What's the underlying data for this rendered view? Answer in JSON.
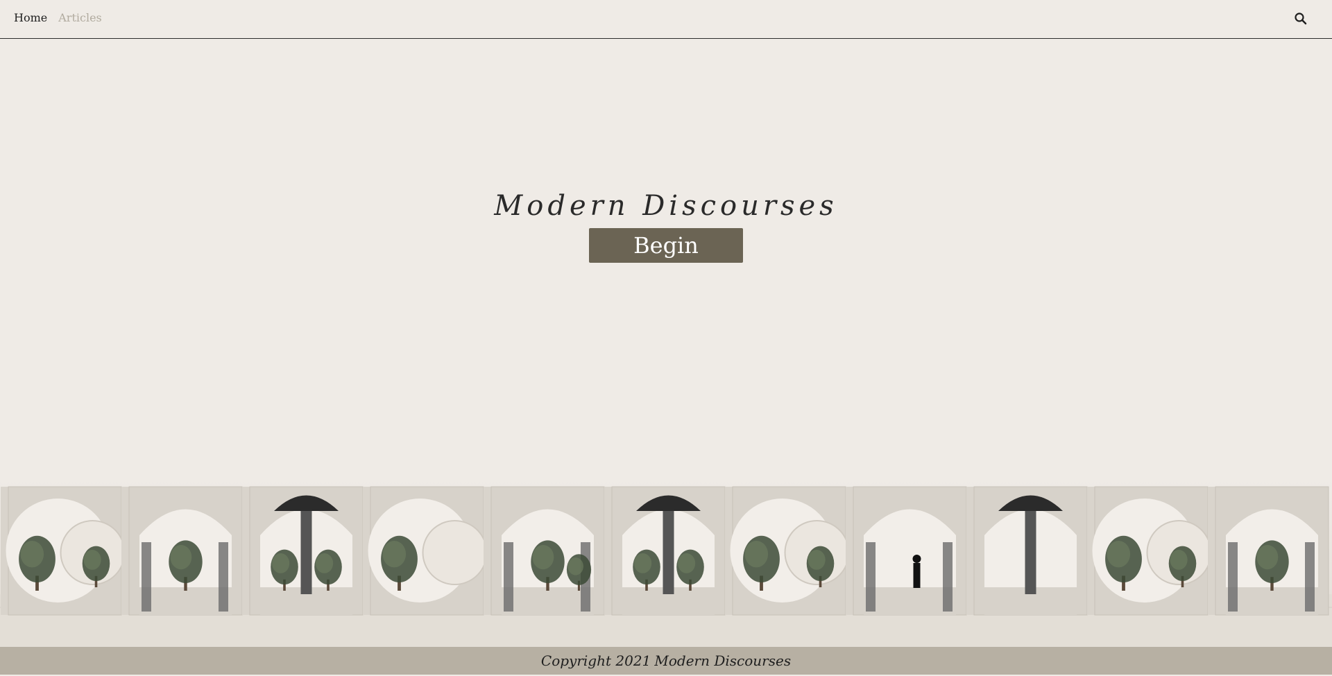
{
  "nav": {
    "items": [
      {
        "label": "Home"
      },
      {
        "label": "Articles"
      }
    ],
    "search_icon": "search-icon"
  },
  "hero": {
    "title": "Modern  Discourses",
    "cta_label": "Begin"
  },
  "footer": {
    "copyright": "Copyright 2021",
    "site_name": "Modern Discourses"
  },
  "colors": {
    "page_bg": "#efebe6",
    "cta_bg": "#6b6454",
    "footer_bg": "#b7b0a3",
    "nav_muted": "#b1ab9f"
  },
  "scene": {
    "panels": [
      {
        "type": "circle",
        "trees": 2
      },
      {
        "type": "arch",
        "trees": 1
      },
      {
        "type": "arch-ceiling",
        "trees": 2
      },
      {
        "type": "circle",
        "trees": 1
      },
      {
        "type": "arch",
        "trees": 2
      },
      {
        "type": "arch-ceiling",
        "trees": 2
      },
      {
        "type": "circle",
        "trees": 2
      },
      {
        "type": "arch-person",
        "trees": 0
      },
      {
        "type": "arch-ceiling",
        "trees": 0
      },
      {
        "type": "circle",
        "trees": 2
      },
      {
        "type": "arch",
        "trees": 1
      }
    ]
  }
}
